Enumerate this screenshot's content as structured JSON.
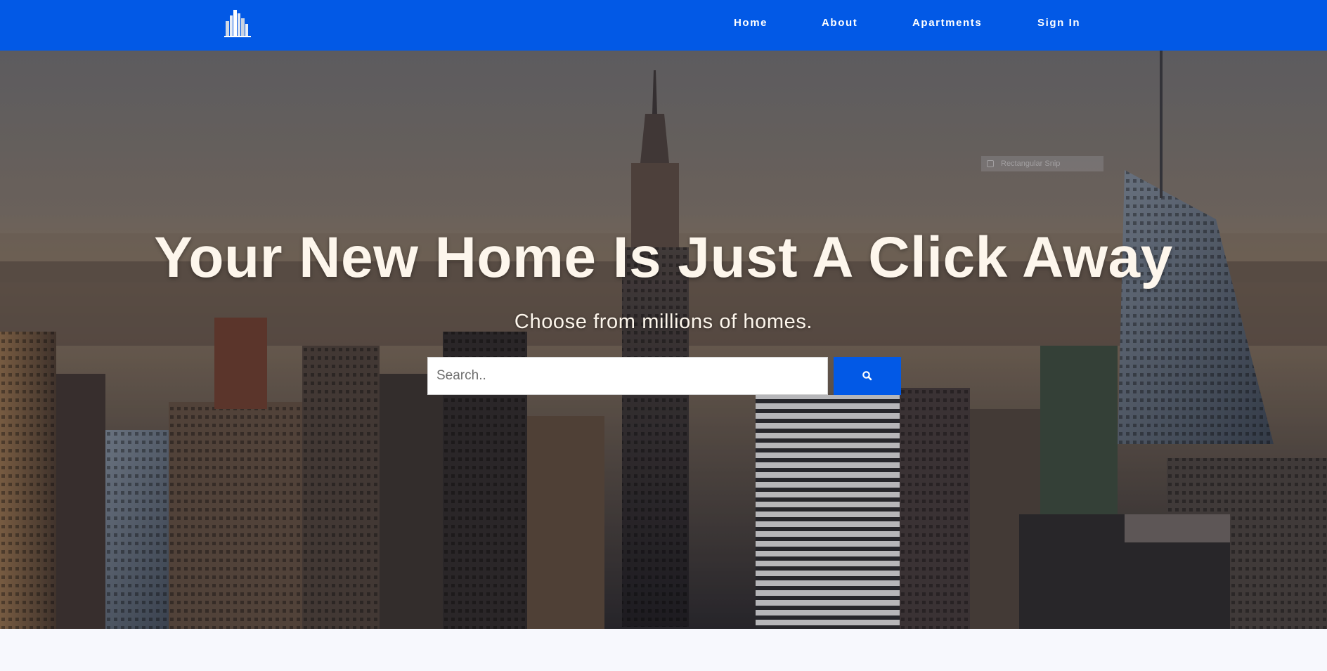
{
  "brand": {
    "logo_icon": "building-logo-icon",
    "color": "#0259e6"
  },
  "nav": {
    "items": [
      {
        "label": "Home"
      },
      {
        "label": "About"
      },
      {
        "label": "Apartments"
      },
      {
        "label": "Sign In"
      }
    ]
  },
  "hero": {
    "title": "Your New Home Is Just A Click Away",
    "subtitle": "Choose from millions of homes.",
    "background": "city-skyline-photo"
  },
  "search": {
    "placeholder": "Search..",
    "value": "",
    "button_icon": "search-icon"
  },
  "overlay_hint": {
    "label": "Rectangular Snip"
  }
}
